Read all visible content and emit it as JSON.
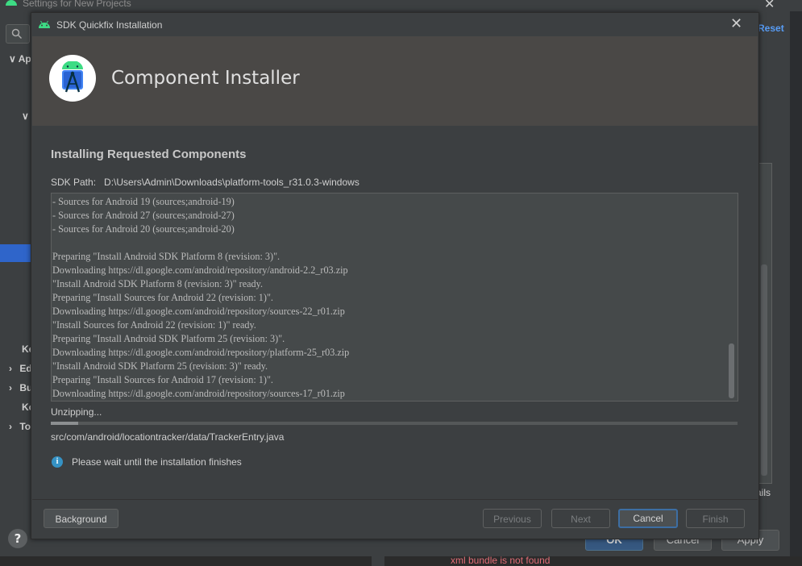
{
  "background_window": {
    "title": "Settings for New Projects",
    "tree_items": [
      "Ap",
      "Ke",
      "Ed",
      "Bu",
      "Ko",
      "To"
    ],
    "reset_link": "Reset",
    "trailing_text": "ails",
    "buttons": {
      "ok": "OK",
      "cancel": "Cancel",
      "apply": "Apply"
    },
    "help_label": "?",
    "error_text": "xml bundle is not found"
  },
  "dialog": {
    "title": "SDK Quickfix Installation",
    "close_glyph": "✕",
    "header_title": "Component Installer",
    "section_title": "Installing Requested Components",
    "sdk_path_label": "SDK Path:",
    "sdk_path_value": "D:\\Users\\Admin\\Downloads\\platform-tools_r31.0.3-windows",
    "log_lines": [
      "- Sources for Android 19 (sources;android-19)",
      "- Sources for Android 27 (sources;android-27)",
      "- Sources for Android 20 (sources;android-20)",
      "",
      "Preparing \"Install Android SDK Platform 8 (revision: 3)\".",
      "Downloading https://dl.google.com/android/repository/android-2.2_r03.zip",
      "\"Install Android SDK Platform 8 (revision: 3)\" ready.",
      "Preparing \"Install Sources for Android 22 (revision: 1)\".",
      "Downloading https://dl.google.com/android/repository/sources-22_r01.zip",
      "\"Install Sources for Android 22 (revision: 1)\" ready.",
      "Preparing \"Install Android SDK Platform 25 (revision: 3)\".",
      "Downloading https://dl.google.com/android/repository/platform-25_r03.zip",
      "\"Install Android SDK Platform 25 (revision: 3)\" ready.",
      "Preparing \"Install Sources for Android 17 (revision: 1)\".",
      "Downloading https://dl.google.com/android/repository/sources-17_r01.zip"
    ],
    "status_text": "Unzipping...",
    "progress_fraction": 0.04,
    "current_file": "src/com/android/locationtracker/data/TrackerEntry.java",
    "info_message": "Please wait until the installation finishes",
    "info_icon_glyph": "i",
    "buttons": {
      "background": "Background",
      "previous": "Previous",
      "next": "Next",
      "cancel": "Cancel",
      "finish": "Finish"
    }
  },
  "colors": {
    "accent_blue": "#3d6ea3",
    "android_green": "#3ddc84",
    "info_blue": "#3592c4",
    "error_red": "#e06c75"
  },
  "icons": {
    "title_icon": "android-icon",
    "logo": "android-studio-logo",
    "search": "search-icon",
    "info": "info-icon"
  }
}
